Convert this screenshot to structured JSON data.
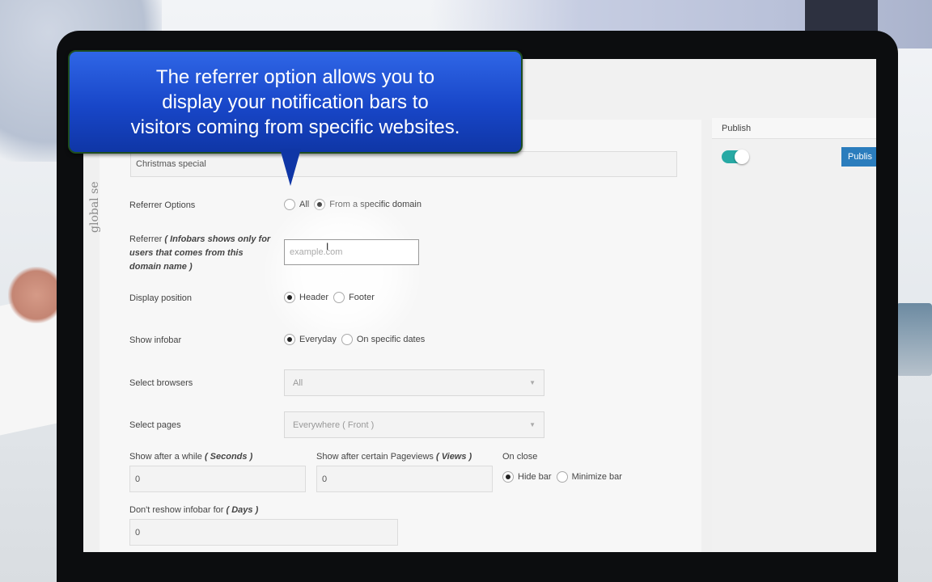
{
  "callout": {
    "line1": "The referrer option allows you to",
    "line2": "display your notification bars  to",
    "line3": "visitors coming from specific websites."
  },
  "sidebar": {
    "vertical_label": "global se",
    "publish_title": "Publish",
    "publish_button": "Publis"
  },
  "form": {
    "title_value": "Christmas special",
    "referrer_options": {
      "label": "Referrer Options",
      "options": [
        "All",
        "From a specific domain"
      ],
      "selected": "From a specific domain"
    },
    "referrer": {
      "label": "Referrer",
      "hint_line1": "( Infobars shows only for",
      "hint_line2": "users that comes from this",
      "hint_line3": "domain name )",
      "placeholder": "example.com"
    },
    "display_position": {
      "label": "Display position",
      "options": [
        "Header",
        "Footer"
      ],
      "selected": "Header"
    },
    "show_infobar": {
      "label": "Show infobar",
      "options": [
        "Everyday",
        "On specific dates"
      ],
      "selected": "Everyday"
    },
    "select_browsers": {
      "label": "Select browsers",
      "value": "All"
    },
    "select_pages": {
      "label": "Select pages",
      "value": "Everywhere ( Front )"
    },
    "show_after_while": {
      "label": "Show after a while",
      "unit": "( Seconds )",
      "value": "0"
    },
    "show_after_pageviews": {
      "label": "Show after certain Pageviews",
      "unit": "( Views )",
      "value": "0"
    },
    "on_close": {
      "label": "On close",
      "options": [
        "Hide bar",
        "Minimize bar"
      ],
      "selected": "Hide bar"
    },
    "dont_reshow": {
      "label": "Don't reshow infobar for",
      "unit": "( Days )",
      "value": "0"
    }
  },
  "icons": {
    "cursor": "text-cursor-icon",
    "caret": "chevron-down-icon"
  },
  "colors": {
    "callout": "#1f4fd6",
    "toggle": "#27a9a4",
    "publish_button": "#2b7dbd"
  }
}
